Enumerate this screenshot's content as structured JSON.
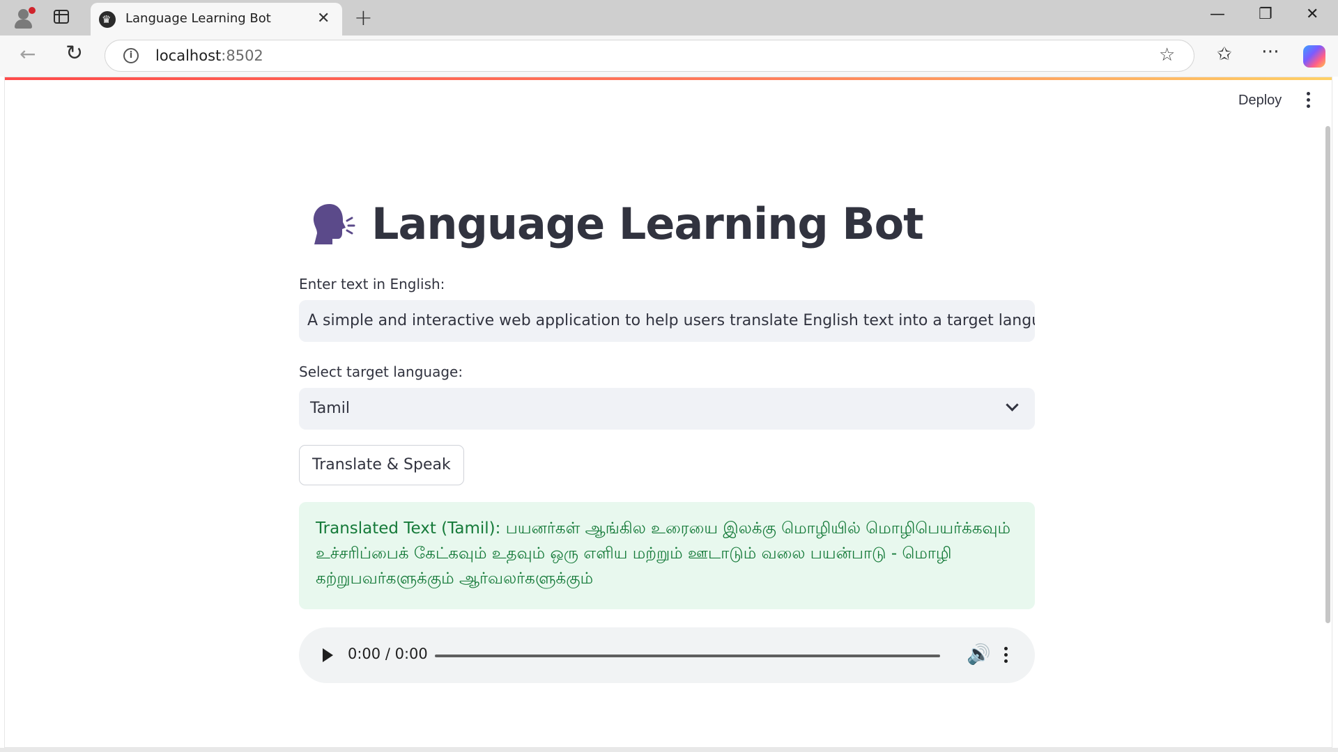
{
  "browser": {
    "tab_title": "Language Learning Bot",
    "url_host": "localhost",
    "url_port": ":8502"
  },
  "header": {
    "deploy_label": "Deploy"
  },
  "main": {
    "title": "Language Learning Bot",
    "input_label": "Enter text in English:",
    "input_value": "A simple and interactive web application to help users translate English text into a target language and h",
    "select_label": "Select target language:",
    "select_value": "Tamil",
    "button_label": "Translate & Speak",
    "result_text": "Translated Text (Tamil): பயனர்கள் ஆங்கில உரையை இலக்கு மொழியில் மொழிபெயர்க்கவும் உச்சரிப்பைக் கேட்கவும் உதவும் ஒரு எளிய மற்றும் ஊடாடும் வலை பயன்பாடு - மொழி கற்றுபவர்களுக்கும் ஆர்வலர்களுக்கும்",
    "audio_time": "0:00 / 0:00"
  },
  "colors": {
    "accent_red": "#ff4b4b",
    "success_bg": "#e8f8ee",
    "success_text": "#157a39",
    "emoji_purple": "#5b4a8a"
  }
}
